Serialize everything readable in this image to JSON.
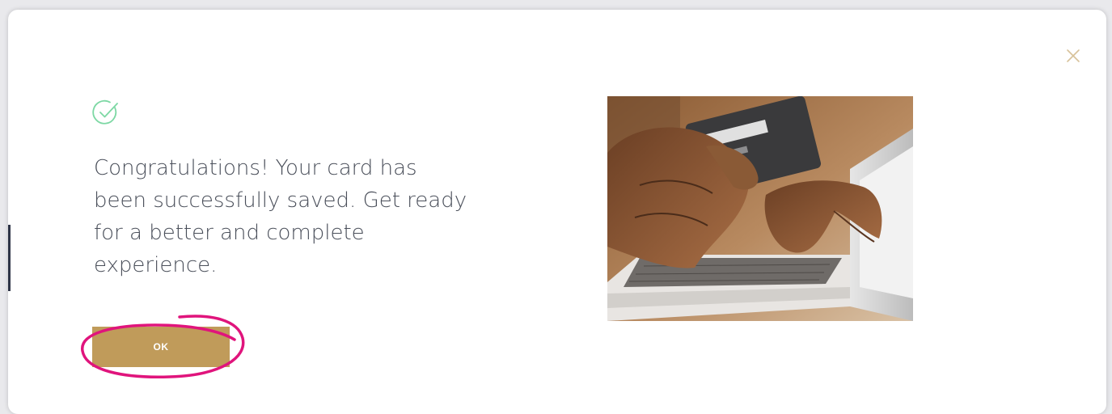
{
  "dialog": {
    "message": "Congratulations! Your card has been successfully saved. Get ready for a better and complete experience.",
    "ok_label": "OK",
    "icons": {
      "close": "close-icon",
      "success": "checkmark-circle-icon"
    }
  },
  "colors": {
    "accent_gold": "#c09b5a",
    "success_green": "#7dd8a4",
    "text": "#4a4f5a",
    "annotation_magenta": "#e0147c"
  }
}
